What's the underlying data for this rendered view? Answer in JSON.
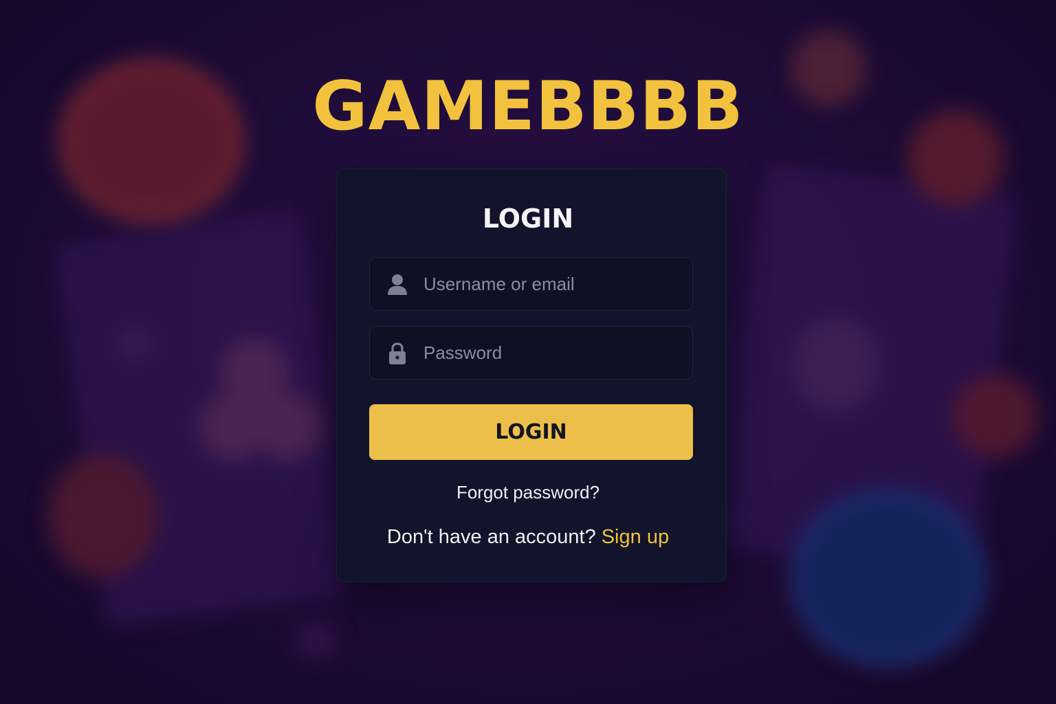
{
  "brand": {
    "name": "GAMEBBBB"
  },
  "login_card": {
    "title": "LOGIN",
    "username": {
      "value": "",
      "placeholder": "Username or email",
      "icon": "user-icon"
    },
    "password": {
      "value": "",
      "placeholder": "Password",
      "icon": "lock-icon"
    },
    "submit_label": "LOGIN",
    "forgot_label": "Forgot password?",
    "signup_prompt": "Don't have an account?",
    "signup_label": "Sign up"
  },
  "colors": {
    "background": "#1b0a33",
    "card": "#11142a",
    "accent": "#ecbf4b",
    "brand_text": "#f2c23e",
    "link": "#f0c23e"
  }
}
